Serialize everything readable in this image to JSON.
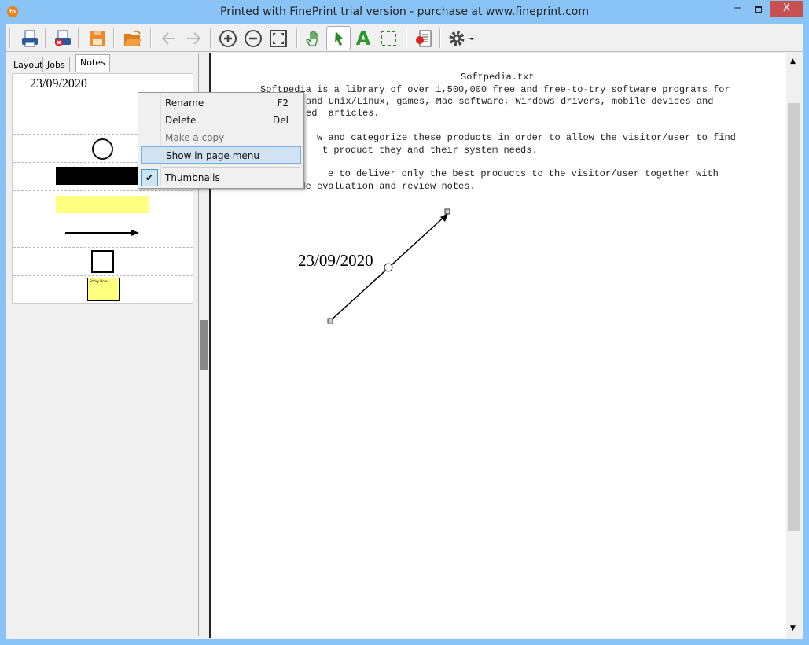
{
  "window": {
    "title": "Printed with FinePrint trial version - purchase at www.fineprint.com",
    "app_icon": "fp",
    "minimize": "‒",
    "close": "X"
  },
  "toolbar": {
    "buttons": [
      "print-icon",
      "cancel-print-icon",
      "save-icon",
      "open-folder-icon",
      "back-arrow-icon",
      "forward-arrow-icon",
      "zoom-in-icon",
      "zoom-out-icon",
      "fit-page-icon",
      "hand-icon",
      "pointer-icon",
      "text-tool-icon",
      "selection-icon",
      "delete-page-icon",
      "gear-icon"
    ]
  },
  "tabs": [
    {
      "label": "Layout"
    },
    {
      "label": "Jobs"
    },
    {
      "label": "Notes",
      "active": true
    }
  ],
  "notes": {
    "date_note": "23/09/2020",
    "sticky_label": "Sticky Note",
    "highlight_color": "#ffff80"
  },
  "context_menu": {
    "items": [
      {
        "label": "Rename",
        "shortcut": "F2"
      },
      {
        "label": "Delete",
        "shortcut": "Del"
      },
      {
        "label": "Make a copy",
        "disabled": true
      },
      {
        "label": "Show in page menu",
        "highlighted": true
      },
      {
        "label": "Thumbnails",
        "checked": true
      }
    ]
  },
  "page": {
    "filename": "Softpedia.txt",
    "lines": [
      "Softpedia is a library of over 1,500,000 free and free-to-try software programs for",
      "and Unix/Linux, games, Mac software, Windows drivers, mobile devices and",
      "ed  articles.",
      "w and categorize these products in order to allow the visitor/user to find",
      "t product they and their system needs.",
      "e to deliver only the best products to the visitor/user together with",
      "self-made evaluation and review notes."
    ],
    "date_annotation": "23/09/2020"
  }
}
